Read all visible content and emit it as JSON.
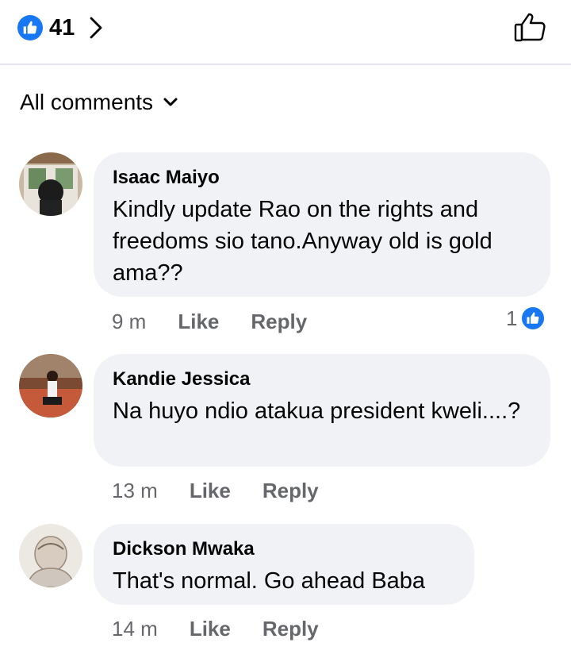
{
  "reactions": {
    "count": "41",
    "like_icon": "like-icon",
    "accent_color": "#1877f2"
  },
  "filter": {
    "label": "All comments",
    "icon": "chevron-down-icon"
  },
  "comments": [
    {
      "author": "Isaac Maiyo",
      "text": "Kindly update Rao on the rights and freedoms sio tano.Anyway old is gold ama??",
      "time": "9 m",
      "like_label": "Like",
      "reply_label": "Reply",
      "reaction_count": "1"
    },
    {
      "author": "Kandie Jessica",
      "text": "Na huyo ndio atakua president kweli....?",
      "time": "13 m",
      "like_label": "Like",
      "reply_label": "Reply"
    },
    {
      "author": "Dickson Mwaka",
      "text": "That's normal. Go ahead Baba",
      "time": "14 m",
      "like_label": "Like",
      "reply_label": "Reply"
    }
  ]
}
